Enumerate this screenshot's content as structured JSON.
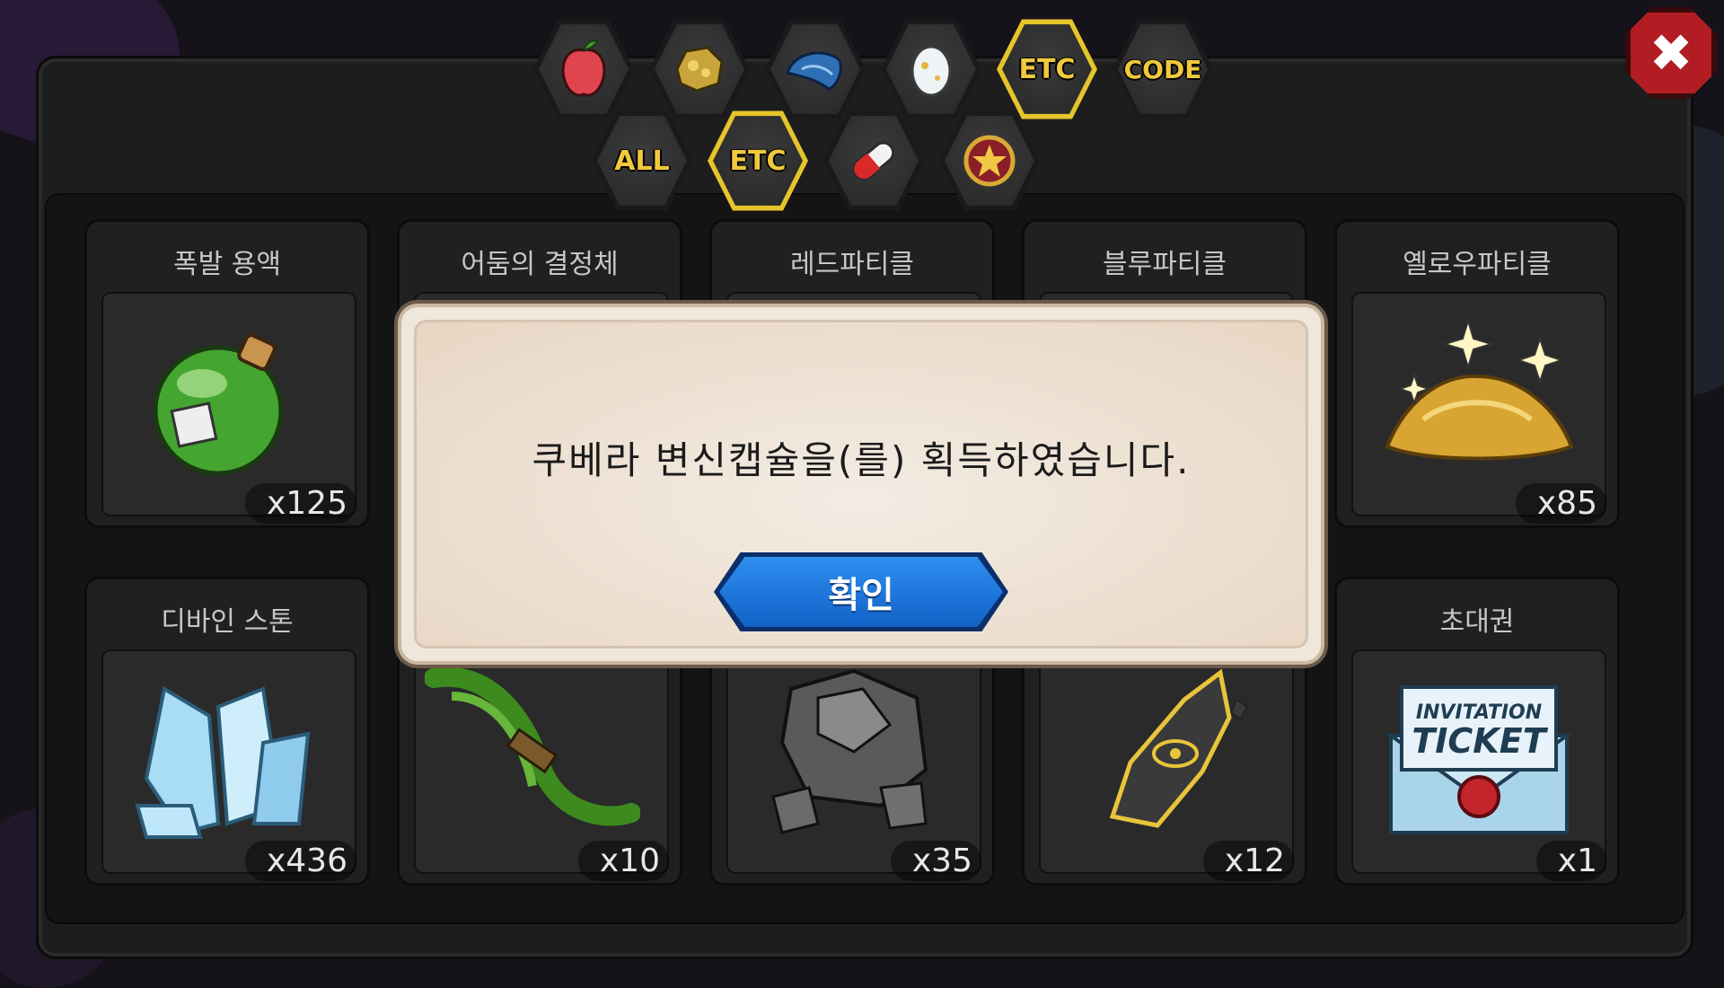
{
  "tabs_top": [
    {
      "label": "",
      "icon": "apple-icon"
    },
    {
      "label": "",
      "icon": "gold-ore-icon"
    },
    {
      "label": "",
      "icon": "blue-scale-icon"
    },
    {
      "label": "",
      "icon": "egg-icon"
    },
    {
      "label": "ETC",
      "icon": "",
      "active": true
    },
    {
      "label": "CODE",
      "icon": ""
    }
  ],
  "tabs_bottom": [
    {
      "label": "ALL",
      "icon": ""
    },
    {
      "label": "ETC",
      "icon": "",
      "active": true
    },
    {
      "label": "",
      "icon": "capsule-icon"
    },
    {
      "label": "",
      "icon": "star-medal-icon"
    }
  ],
  "items": [
    {
      "name": "폭발 용액",
      "count": "x125",
      "icon": "green-potion-icon"
    },
    {
      "name": "어둠의 결정체",
      "count": "",
      "icon": "dark-crystal-icon"
    },
    {
      "name": "레드파티클",
      "count": "",
      "icon": "red-particle-icon"
    },
    {
      "name": "블루파티클",
      "count": "",
      "icon": "blue-particle-icon"
    },
    {
      "name": "옐로우파티클",
      "count": "x85",
      "icon": "yellow-particle-icon"
    },
    {
      "name": "디바인 스톤",
      "count": "x436",
      "icon": "divine-stone-icon"
    },
    {
      "name": "",
      "count": "x10",
      "icon": "herb-bundle-icon"
    },
    {
      "name": "",
      "count": "x35",
      "icon": "ore-rocks-icon"
    },
    {
      "name": "",
      "count": "x12",
      "icon": "rune-shard-icon"
    },
    {
      "name": "초대권",
      "count": "x1",
      "icon": "invitation-ticket-icon",
      "ticket_text_1": "INVITATION",
      "ticket_text_2": "TICKET"
    }
  ],
  "dialog": {
    "message": "쿠베라 변신캡슐을(를) 획득하였습니다.",
    "confirm_label": "확인"
  },
  "close_label": "✖"
}
